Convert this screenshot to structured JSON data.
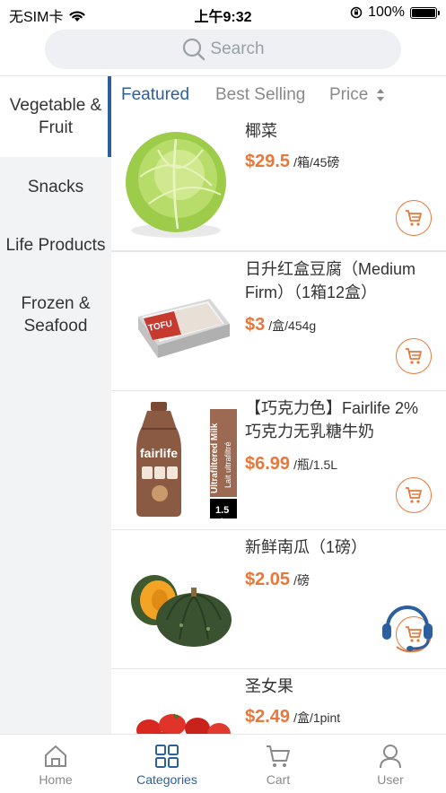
{
  "status_bar": {
    "carrier": "无SIM卡",
    "time": "上午9:32",
    "battery": "100%"
  },
  "search": {
    "placeholder": "Search"
  },
  "sidebar": {
    "items": [
      {
        "label": "Vegetable & Fruit",
        "active": true
      },
      {
        "label": "Snacks"
      },
      {
        "label": "Life Products"
      },
      {
        "label": "Frozen & Seafood"
      }
    ]
  },
  "tabs": [
    {
      "label": "Featured",
      "active": true
    },
    {
      "label": "Best Selling"
    },
    {
      "label": "Price"
    }
  ],
  "products": [
    {
      "name": "椰菜",
      "price": "$29.5",
      "unit": "/箱/45磅",
      "image": "cabbage"
    },
    {
      "name": "日升红盒豆腐（Medium Firm）（1箱12盒）",
      "price": "$3",
      "unit": "/盒/454g",
      "image": "tofu-box",
      "image_text": "TOFU"
    },
    {
      "name": "【巧克力色】Fairlife 2% 巧克力无乳糖牛奶",
      "price": "$6.99",
      "unit": "/瓶/1.5L",
      "image": "fairlife-milk-bottle",
      "image_text": {
        "brand": "fairlife",
        "side": "Ultrafiltered Milk",
        "side2": "Lait ultrafiltré",
        "size": "1.5",
        "size_unit": "L"
      }
    },
    {
      "name": "新鲜南瓜（1磅）",
      "price": "$2.05",
      "unit": "/磅",
      "image": "kabocha-squash"
    },
    {
      "name": "圣女果",
      "price": "$2.49",
      "unit": "/盒/1pint",
      "image": "cherry-tomatoes"
    }
  ],
  "bottom_nav": [
    {
      "label": "Home",
      "icon": "home-icon"
    },
    {
      "label": "Categories",
      "icon": "grid-icon",
      "active": true
    },
    {
      "label": "Cart",
      "icon": "cart-icon"
    },
    {
      "label": "User",
      "icon": "user-icon"
    }
  ],
  "colors": {
    "accent_blue": "#2b5f9e",
    "price_orange": "#e8773a",
    "sidebar_bg": "#f2f3f5"
  }
}
